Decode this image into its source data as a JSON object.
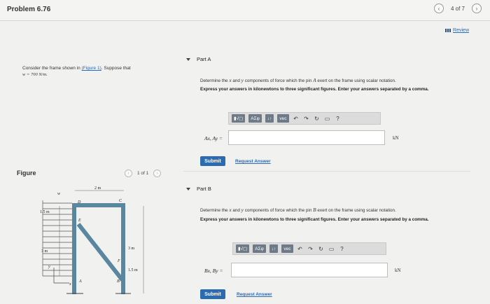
{
  "header": {
    "title": "Problem 6.76",
    "pager_text": "4 of 7",
    "prev_icon": "chevron-left-icon",
    "next_icon": "chevron-right-icon"
  },
  "review": {
    "label": "Review"
  },
  "problem": {
    "intro": "Consider the frame shown in",
    "figure_link": "(Figure 1)",
    "suffix": ". Suppose that",
    "given": "w = 700 N/m."
  },
  "figure_section": {
    "label": "Figure",
    "pager_text": "1 of 1",
    "diagram": {
      "labels": {
        "w": "w",
        "top_dim": "2 m",
        "left_dim_1": "1.5 m",
        "left_dim_2": "3 m",
        "right_dim_1": "3 m",
        "right_dim_2": "1.5 m",
        "A": "A",
        "B": "B",
        "C": "C",
        "D": "D",
        "E": "E",
        "F": "F",
        "y_axis": "y",
        "x_axis": "x"
      }
    }
  },
  "parts": [
    {
      "title": "Part A",
      "question_pre": "Determine the",
      "question_x": "x",
      "question_and": "and",
      "question_y": "y",
      "question_mid": "components of force which the pin",
      "question_pin": "A",
      "question_post": "exert on the frame using scalar notation.",
      "instruction": "Express your answers in kilonewtons to three significant figures. Enter your answers separated by a comma.",
      "answer_label": "Ax, Ay =",
      "answer_value": "",
      "unit": "kN",
      "submit_label": "Submit",
      "request_label": "Request Answer"
    },
    {
      "title": "Part B",
      "question_pre": "Determine the",
      "question_x": "x",
      "question_and": "and",
      "question_y": "y",
      "question_mid": "components of force which the pin",
      "question_pin": "B",
      "question_post": "exert on the frame using scalar notation.",
      "instruction": "Express your answers in kilonewtons to three significant figures. Enter your answers separated by a comma.",
      "answer_label": "Bx, By =",
      "answer_value": "",
      "unit": "kN",
      "submit_label": "Submit",
      "request_label": "Request Answer"
    }
  ],
  "toolbar": {
    "templates_label": "▮√▢",
    "greek_label": "ΑΣφ",
    "arrows_label": "↓↑",
    "vec_label": "vec",
    "undo_icon": "undo-icon",
    "redo_icon": "redo-icon",
    "reset_icon": "reset-icon",
    "keyboard_icon": "keyboard-icon",
    "help_label": "?"
  }
}
